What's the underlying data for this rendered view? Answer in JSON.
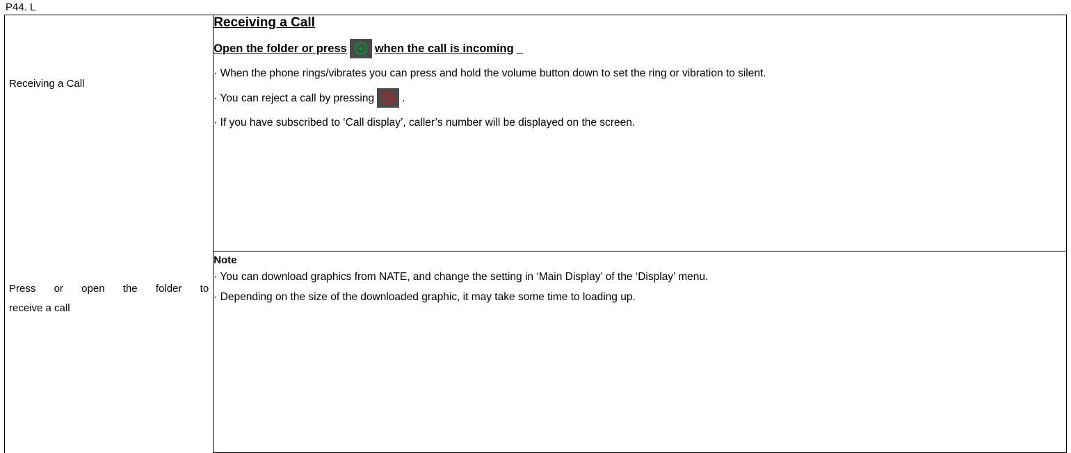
{
  "page_label": "P44. L",
  "left": {
    "section_title": "Receiving a Call",
    "instruction_line1": "Press or open the folder to",
    "instruction_line2": "receive a call"
  },
  "main": {
    "heading": "Receiving a Call",
    "subheading_before": "Open the folder or press",
    "subheading_after": "when the call is incoming",
    "bullet1": "· When the phone rings/vibrates you can press and hold the volume button down to set the ring or vibration to silent.",
    "bullet2_before": "· You can reject a call by pressing",
    "bullet2_after": ".",
    "bullet3": "· If you have subscribed to ‘Call display’, caller’s number will be displayed on the screen."
  },
  "note": {
    "heading": "Note",
    "line1": "· You can download graphics from NATE, and change the setting in ‘Main Display’ of the ‘Display’ menu.",
    "line2": "· Depending on the size of the downloaded graphic, it may take some time to loading up."
  }
}
